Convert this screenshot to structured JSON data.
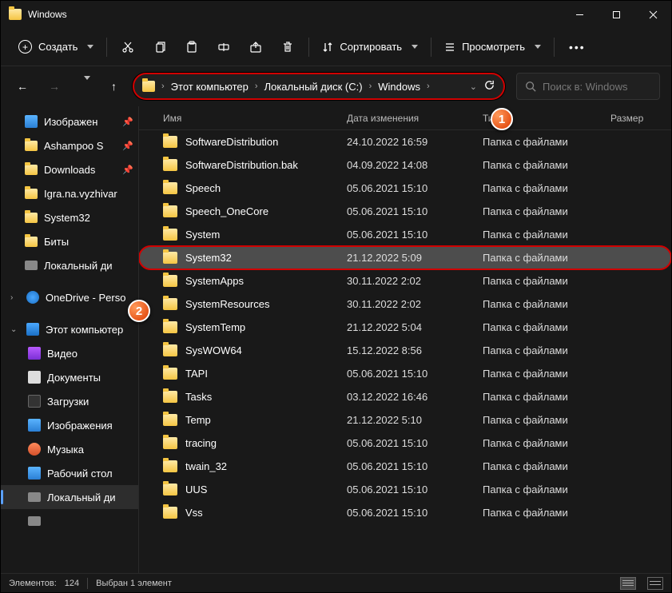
{
  "title": "Windows",
  "toolbar": {
    "create": "Создать",
    "sort": "Сортировать",
    "view": "Просмотреть"
  },
  "breadcrumb": {
    "items": [
      "Этот компьютер",
      "Локальный диск (C:)",
      "Windows"
    ]
  },
  "search": {
    "placeholder": "Поиск в: Windows"
  },
  "columns": {
    "name": "Имя",
    "date": "Дата изменения",
    "type": "Тип",
    "size": "Размер"
  },
  "sidebar": [
    {
      "icon": "pic",
      "label": "Изображен",
      "pin": true
    },
    {
      "icon": "folder",
      "label": "Ashampoo S",
      "pin": true
    },
    {
      "icon": "folder",
      "label": "Downloads",
      "pin": true
    },
    {
      "icon": "folder",
      "label": "Igra.na.vyzhivar",
      "pin": false
    },
    {
      "icon": "folder",
      "label": "System32",
      "pin": false
    },
    {
      "icon": "folder",
      "label": "Биты",
      "pin": false
    },
    {
      "icon": "disk",
      "label": "Локальный ди",
      "pin": false
    },
    {
      "spacer": true
    },
    {
      "icon": "cloud",
      "label": "OneDrive - Perso",
      "expand": ">",
      "level": 1
    },
    {
      "spacer": true
    },
    {
      "icon": "pc",
      "label": "Этот компьютер",
      "expand": "v",
      "level": 1
    },
    {
      "icon": "video",
      "label": "Видео",
      "level": 2
    },
    {
      "icon": "doc",
      "label": "Документы",
      "level": 2
    },
    {
      "icon": "dl",
      "label": "Загрузки",
      "level": 2
    },
    {
      "icon": "pic",
      "label": "Изображения",
      "level": 2
    },
    {
      "icon": "music",
      "label": "Музыка",
      "level": 2
    },
    {
      "icon": "desk",
      "label": "Рабочий стол",
      "level": 2
    },
    {
      "icon": "disk",
      "label": "Локальный ди",
      "level": 2,
      "selected": true
    },
    {
      "icon": "disk",
      "label": "",
      "level": 2
    }
  ],
  "rows": [
    {
      "name": "SoftwareDistribution",
      "date": "24.10.2022 16:59",
      "type": "Папка с файлами"
    },
    {
      "name": "SoftwareDistribution.bak",
      "date": "04.09.2022 14:08",
      "type": "Папка с файлами"
    },
    {
      "name": "Speech",
      "date": "05.06.2021 15:10",
      "type": "Папка с файлами"
    },
    {
      "name": "Speech_OneCore",
      "date": "05.06.2021 15:10",
      "type": "Папка с файлами"
    },
    {
      "name": "System",
      "date": "05.06.2021 15:10",
      "type": "Папка с файлами"
    },
    {
      "name": "System32",
      "date": "21.12.2022 5:09",
      "type": "Папка с файлами",
      "selected": true
    },
    {
      "name": "SystemApps",
      "date": "30.11.2022 2:02",
      "type": "Папка с файлами"
    },
    {
      "name": "SystemResources",
      "date": "30.11.2022 2:02",
      "type": "Папка с файлами"
    },
    {
      "name": "SystemTemp",
      "date": "21.12.2022 5:04",
      "type": "Папка с файлами"
    },
    {
      "name": "SysWOW64",
      "date": "15.12.2022 8:56",
      "type": "Папка с файлами"
    },
    {
      "name": "TAPI",
      "date": "05.06.2021 15:10",
      "type": "Папка с файлами"
    },
    {
      "name": "Tasks",
      "date": "03.12.2022 16:46",
      "type": "Папка с файлами"
    },
    {
      "name": "Temp",
      "date": "21.12.2022 5:10",
      "type": "Папка с файлами"
    },
    {
      "name": "tracing",
      "date": "05.06.2021 15:10",
      "type": "Папка с файлами"
    },
    {
      "name": "twain_32",
      "date": "05.06.2021 15:10",
      "type": "Папка с файлами"
    },
    {
      "name": "UUS",
      "date": "05.06.2021 15:10",
      "type": "Папка с файлами"
    },
    {
      "name": "Vss",
      "date": "05.06.2021 15:10",
      "type": "Папка с файлами"
    }
  ],
  "status": {
    "count_label": "Элементов:",
    "count": "124",
    "sel_label": "Выбран 1 элемент"
  },
  "callouts": {
    "c1": "1",
    "c2": "2"
  }
}
